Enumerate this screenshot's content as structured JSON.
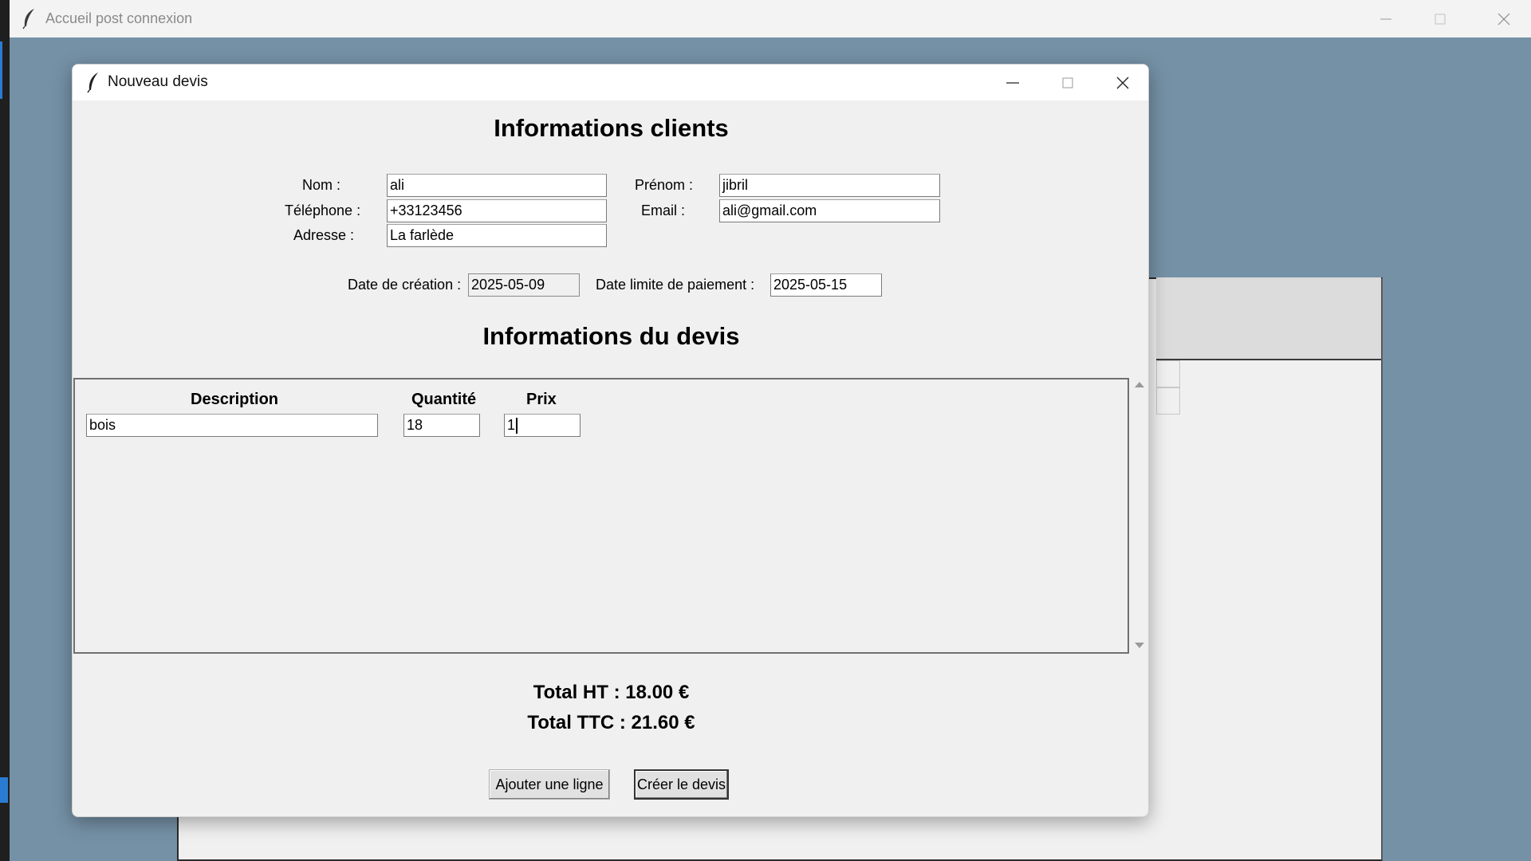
{
  "main_window": {
    "title": "Accueil post connexion"
  },
  "dialog": {
    "title": "Nouveau devis",
    "heading_clients": "Informations clients",
    "heading_devis": "Informations du devis",
    "client": {
      "nom_label": "Nom :",
      "nom_value": "ali",
      "prenom_label": "Prénom :",
      "prenom_value": "jibril",
      "telephone_label": "Téléphone :",
      "telephone_value": "+33123456",
      "email_label": "Email :",
      "email_value": "ali@gmail.com",
      "adresse_label": "Adresse :",
      "adresse_value": "La farlède"
    },
    "dates": {
      "creation_label": "Date de création :",
      "creation_value": "2025-05-09",
      "limite_label": "Date limite de paiement :",
      "limite_value": "2025-05-15"
    },
    "items": {
      "columns": [
        "Description",
        "Quantité",
        "Prix"
      ],
      "rows": [
        {
          "description": "bois",
          "quantite": "18",
          "prix": "1"
        }
      ]
    },
    "totals": {
      "ht": "Total HT : 18.00 €",
      "ttc": "Total TTC : 21.60 €"
    },
    "buttons": {
      "add_line": "Ajouter une ligne",
      "create": "Créer le devis"
    }
  },
  "icons": {
    "title_icon": "feather-icon",
    "minimize": "minimize-icon",
    "maximize": "maximize-icon",
    "close": "close-icon",
    "scroll_up": "scroll-up-arrow-icon",
    "scroll_down": "scroll-down-arrow-icon"
  }
}
